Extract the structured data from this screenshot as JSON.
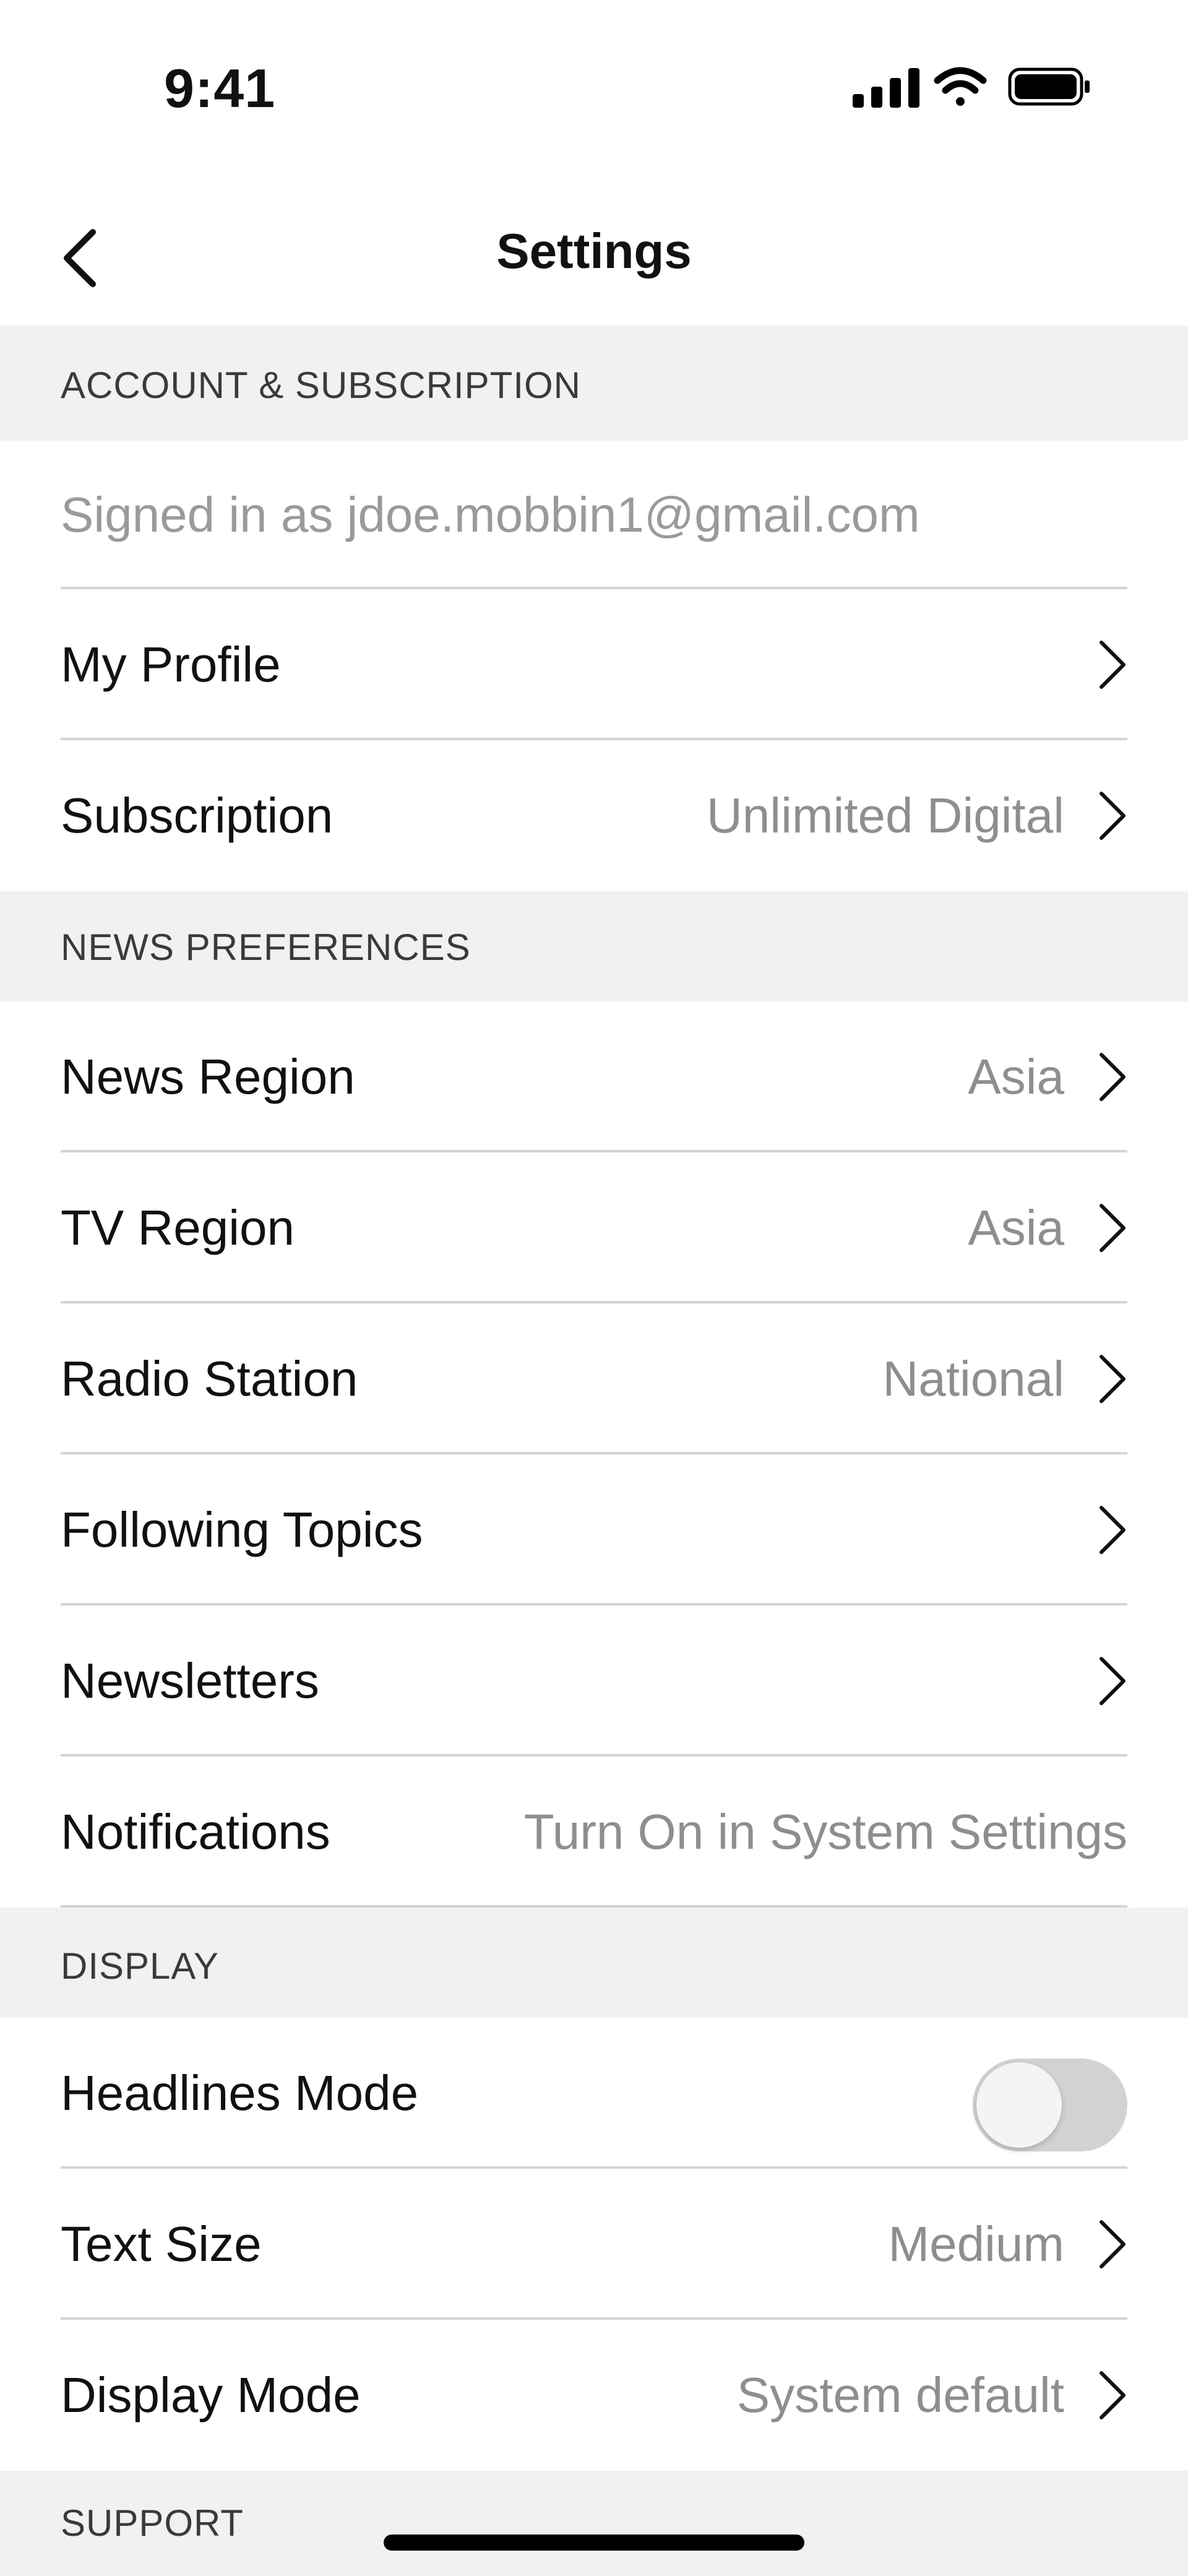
{
  "status_bar": {
    "time": "9:41",
    "icons": [
      "cellular-signal-icon",
      "wifi-icon",
      "battery-icon"
    ]
  },
  "nav": {
    "title": "Settings",
    "back_icon": "chevron-left-icon"
  },
  "sections": {
    "account": {
      "header": "ACCOUNT & SUBSCRIPTION",
      "signed_in": "Signed in as jdoe.mobbin1@gmail.com",
      "my_profile": {
        "label": "My Profile"
      },
      "subscription": {
        "label": "Subscription",
        "value": "Unlimited Digital"
      }
    },
    "news": {
      "header": "NEWS PREFERENCES",
      "news_region": {
        "label": "News Region",
        "value": "Asia"
      },
      "tv_region": {
        "label": "TV Region",
        "value": "Asia"
      },
      "radio_station": {
        "label": "Radio Station",
        "value": "National"
      },
      "following_topics": {
        "label": "Following Topics"
      },
      "newsletters": {
        "label": "Newsletters"
      },
      "notifications": {
        "label": "Notifications",
        "value": "Turn On in System Settings"
      }
    },
    "display": {
      "header": "DISPLAY",
      "headlines_mode": {
        "label": "Headlines Mode",
        "toggle_on": false
      },
      "text_size": {
        "label": "Text Size",
        "value": "Medium"
      },
      "display_mode": {
        "label": "Display Mode",
        "value": "System default"
      }
    },
    "support": {
      "header": "SUPPORT"
    }
  },
  "colors": {
    "section_bg": "#f1f1f1",
    "secondary_text": "#8e8e8e",
    "divider": "#d4d4d4",
    "toggle_off": "#d2d2d2"
  }
}
